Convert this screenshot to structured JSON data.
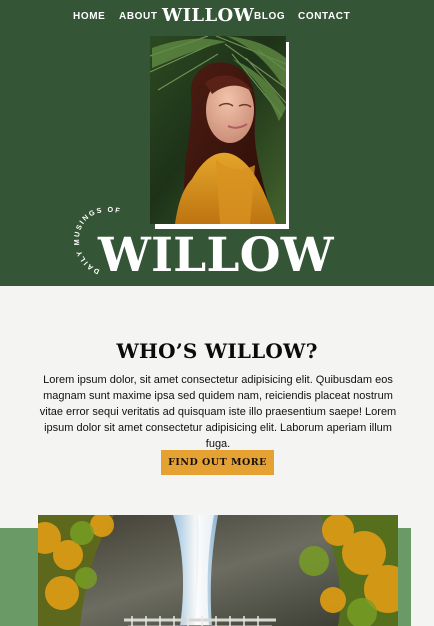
{
  "nav": {
    "home": "HOME",
    "about": "ABOUT",
    "logo": "WILLOW",
    "blog": "BLOG",
    "contact": "CONTACT"
  },
  "hero": {
    "curved_text": "DAILY MUSINGS OF",
    "wordmark": "WILLOW",
    "photo_subject": "woman-in-yellow-jacket-with-palm-leaves"
  },
  "intro": {
    "title": "WHO’S WILLOW?",
    "body": "Lorem ipsum dolor, sit amet consectetur adipisicing elit. Quibusdam eos magnam sunt maxime ipsa sed quidem nam, reiciendis placeat nostrum vitae error sequi veritatis ad quisquam iste illo praesentium saepe! Lorem ipsum dolor sit amet consectetur adipisicing elit. Laborum aperiam illum fuga.",
    "button_label": "FIND OUT MORE"
  },
  "feature": {
    "image_subject": "waterfall-with-autumn-trees-and-bridge"
  },
  "colors": {
    "forest_green": "#355537",
    "sage_green": "#6a9a66",
    "mustard": "#e6a133",
    "background": "#f4f4f3",
    "white": "#ffffff",
    "text": "#111111"
  }
}
